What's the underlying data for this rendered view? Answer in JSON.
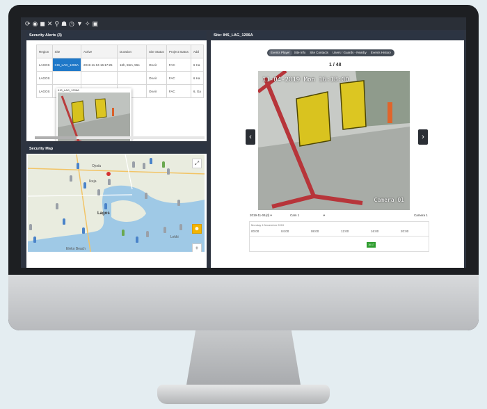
{
  "toolbar": {
    "icons": [
      {
        "name": "refresh-icon",
        "glyph": "⟳"
      },
      {
        "name": "alert-icon",
        "glyph": "◉"
      },
      {
        "name": "camera-icon",
        "glyph": "◼"
      },
      {
        "name": "tools-icon",
        "glyph": "✕"
      },
      {
        "name": "search-icon",
        "glyph": "⚲"
      },
      {
        "name": "user-icon",
        "glyph": "☗"
      },
      {
        "name": "clock-icon",
        "glyph": "◷"
      },
      {
        "name": "filter-icon",
        "glyph": "▼"
      },
      {
        "name": "signal-icon",
        "glyph": "✧"
      },
      {
        "name": "lock-icon",
        "glyph": "▣"
      }
    ]
  },
  "alerts": {
    "title": "Security Alerts (3)",
    "columns": [
      "Region",
      "Site",
      "Active",
      "Duration",
      "Site Status",
      "Project Status",
      "Add"
    ],
    "rows": [
      [
        "LAGOS",
        "IHS_LAG_1206A",
        "2019-11-04 16:17:25",
        "16h, 55m, 55s",
        "OnAir",
        "FAC",
        "6 Ha"
      ],
      [
        "LAGOS",
        "",
        "",
        "",
        "OnAir",
        "FAC",
        "6 Ha"
      ],
      [
        "LAGOS",
        "",
        "",
        "",
        "OnAir",
        "FAC",
        "6, Ga"
      ]
    ],
    "popup_caption": "IHS_LAG_1206A"
  },
  "map": {
    "title": "Security Map",
    "labels": [
      "Ojodu",
      "Ikeja",
      "Lagos",
      "Lekki",
      "Eleko Beach"
    ]
  },
  "site": {
    "title": "Site: IHS_LAG_1206A",
    "tabs": [
      "Events Player",
      "Site Info",
      "Site Contacts",
      "Users / Guards - Nearby",
      "Events History"
    ],
    "counter": "1 / 48",
    "camera": {
      "timestamp": "11-04-2019 Mon 16:18:00",
      "label": "Camera 01"
    },
    "date_select": "2019-11-04(d)",
    "cam_select": "Cam 1",
    "camera_name": "Camera 1",
    "timeline": {
      "date_label": "Monday 4 November 2019",
      "ticks": [
        "00:00",
        "04:00",
        "08:00",
        "12:00",
        "16:00",
        "20:00"
      ],
      "event_label": "16:17"
    }
  }
}
